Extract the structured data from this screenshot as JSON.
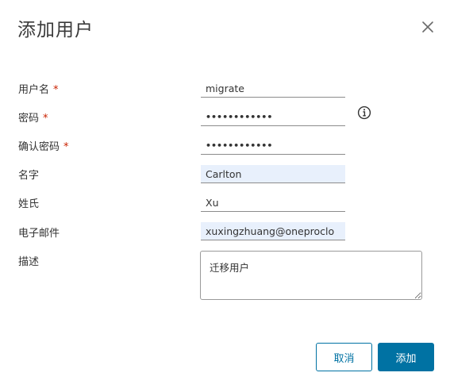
{
  "dialog": {
    "title": "添加用户",
    "close_icon": "close-icon"
  },
  "form": {
    "username": {
      "label": "用户名",
      "required": "*",
      "value": "migrate"
    },
    "password": {
      "label": "密码",
      "required": "*",
      "value": "migrate12345",
      "info_icon": "info-icon"
    },
    "confirm_password": {
      "label": "确认密码",
      "required": "*",
      "value": "migrate12345"
    },
    "first_name": {
      "label": "名字",
      "value": "Carlton"
    },
    "last_name": {
      "label": "姓氏",
      "value": "Xu"
    },
    "email": {
      "label": "电子邮件",
      "value": "xuxingzhuang@oneproclo"
    },
    "description": {
      "label": "描述",
      "value": "迁移用户"
    }
  },
  "footer": {
    "cancel_label": "取消",
    "add_label": "添加"
  },
  "colors": {
    "primary": "#0072a3",
    "required": "#c92100",
    "autofill_bg": "#e8f0fc"
  }
}
